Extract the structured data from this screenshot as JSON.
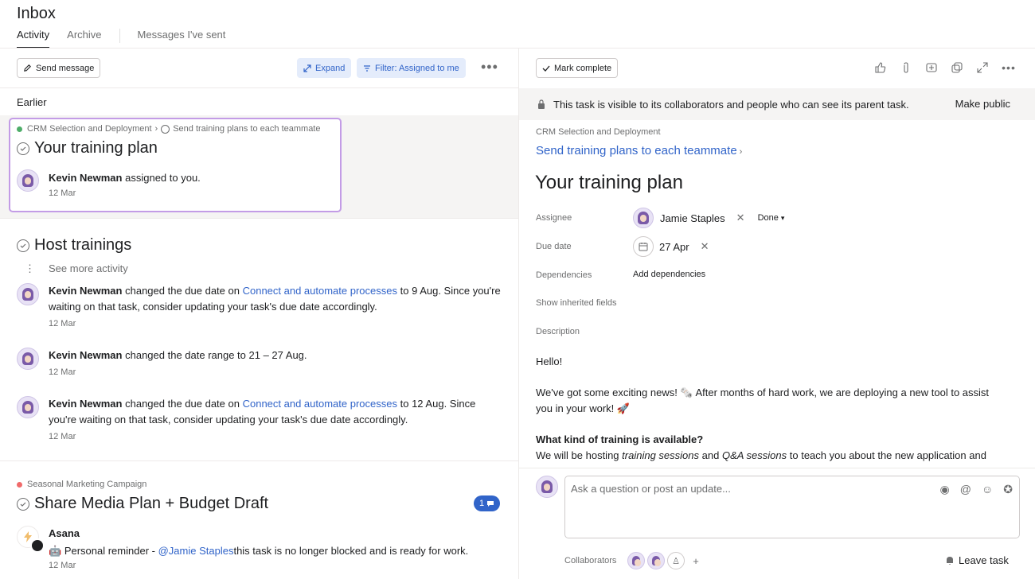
{
  "header": {
    "title": "Inbox",
    "tabs": [
      "Activity",
      "Archive",
      "Messages I've sent"
    ]
  },
  "left_toolbar": {
    "send_message": "Send message",
    "expand": "Expand",
    "filter": "Filter: Assigned to me"
  },
  "feed": {
    "earlier_label": "Earlier",
    "card1": {
      "project": "CRM Selection and Deployment",
      "parent_task": "Send training plans to each teammate",
      "title": "Your training plan",
      "user": "Kevin Newman",
      "action": "assigned to you.",
      "date": "12 Mar"
    },
    "card2": {
      "title": "Host trainings",
      "see_more": "See more activity",
      "story1": {
        "user": "Kevin Newman",
        "text1": "changed the due date on",
        "link": "Connect and automate processes",
        "text2": "to 9 Aug. Since you're waiting on that task, consider updating your task's due date accordingly.",
        "date": "12 Mar"
      },
      "story2": {
        "user": "Kevin Newman",
        "text": "changed the date range to 21 – 27 Aug.",
        "date": "12 Mar"
      },
      "story3": {
        "user": "Kevin Newman",
        "text1": "changed the due date on",
        "link": "Connect and automate processes",
        "text2": "to 12 Aug. Since you're waiting on that task, consider updating your task's due date accordingly.",
        "date": "12 Mar"
      }
    },
    "card3": {
      "project": "Seasonal Marketing Campaign",
      "title": "Share Media Plan + Budget Draft",
      "comment_count": "1",
      "user": "Asana",
      "emoji": "🤖",
      "text1": "Personal reminder -",
      "mention": "@Jamie Staples",
      "text2": "this task is no longer blocked and is ready for work.",
      "date": "12 Mar"
    }
  },
  "task_pane": {
    "mark_complete": "Mark complete",
    "banner_text": "This task is visible to its collaborators and people who can see its parent task.",
    "make_public": "Make public",
    "project": "CRM Selection and Deployment",
    "parent_task": "Send training plans to each teammate",
    "title": "Your training plan",
    "assignee_label": "Assignee",
    "assignee": "Jamie Staples",
    "done_label": "Done",
    "due_label": "Due date",
    "due_date": "27 Apr",
    "dependencies_label": "Dependencies",
    "add_dependencies": "Add dependencies",
    "show_inherited": "Show inherited fields",
    "description_label": "Description",
    "desc_hello": "Hello!",
    "desc_p1a": "We've got some exciting news! 🗞️ After months of hard work, we are deploying a new tool to assist you in your work! 🚀",
    "desc_heading": "What kind of training is available?",
    "desc_p2a": "We will be hosting",
    "desc_p2b": "training sessions",
    "desc_p2c": "and",
    "desc_p2d": "Q&A sessions",
    "desc_p2e": "to teach you about the new application and",
    "comment_placeholder": "Ask a question or post an update...",
    "collaborators_label": "Collaborators",
    "leave_task": "Leave task"
  }
}
